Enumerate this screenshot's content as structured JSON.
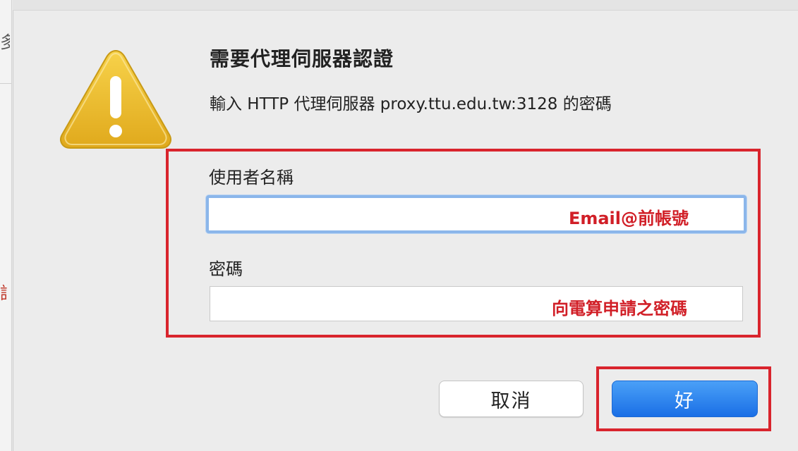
{
  "background": {
    "glyph_top": "多",
    "glyph_mid": "請"
  },
  "dialog": {
    "title": "需要代理伺服器認證",
    "subtitle": "輸入 HTTP 代理伺服器 proxy.ttu.edu.tw:3128 的密碼",
    "username_label": "使用者名稱",
    "username_value": "",
    "username_hint": "Email@前帳號",
    "password_label": "密碼",
    "password_value": "",
    "password_hint": "向電算申請之密碼",
    "cancel_label": "取消",
    "ok_label": "好"
  },
  "colors": {
    "annotation_red": "#d9242d",
    "hint_red": "#d11f27",
    "primary_blue": "#1a6fe6",
    "focus_ring": "#8bb6ea",
    "warning_yellow": "#f2c12e"
  },
  "icons": {
    "warning": "warning-triangle-icon"
  }
}
